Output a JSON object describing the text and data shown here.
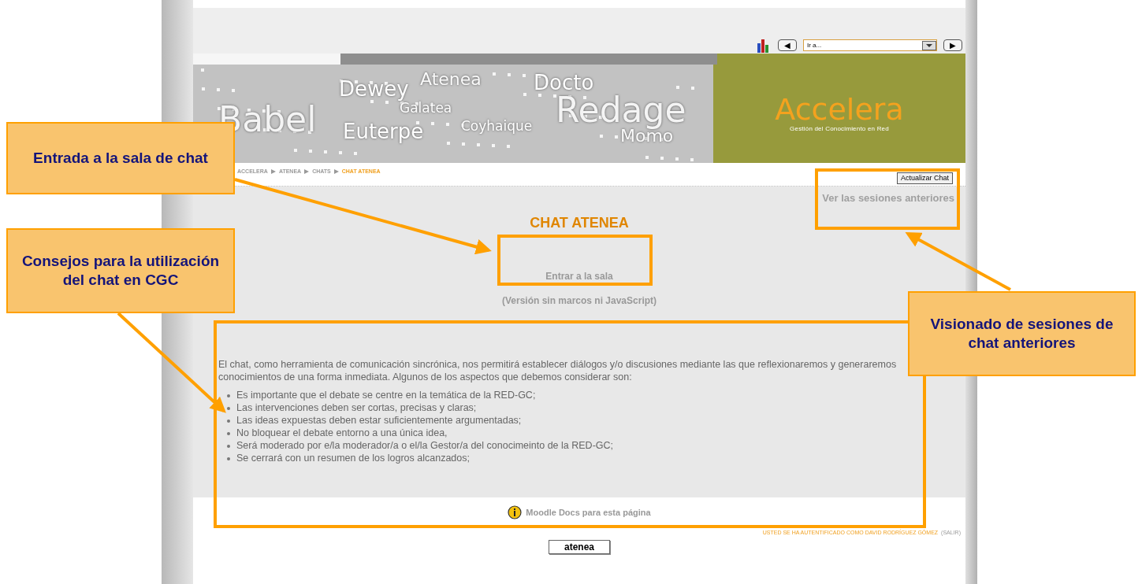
{
  "nav": {
    "prev": "◀",
    "select": "Ir a...",
    "next": "▶"
  },
  "banner": {
    "words": [
      {
        "text": "Babel",
        "kind": "big"
      },
      {
        "text": "Dewey",
        "kind": "mid"
      },
      {
        "text": "Atenea",
        "kind": "faint"
      },
      {
        "text": "Galatea",
        "kind": "small"
      },
      {
        "text": "Euterpe",
        "kind": "mid"
      },
      {
        "text": "Coyhaique",
        "kind": "small"
      },
      {
        "text": "Docto",
        "kind": "mid"
      },
      {
        "text": "Redage",
        "kind": "big"
      },
      {
        "text": "Momo",
        "kind": "faint"
      }
    ],
    "logo": "Accelera",
    "tagline": "Gestión del Conocimiento en Red"
  },
  "breadcrumb": [
    {
      "text": "ACCELERA",
      "selected": false
    },
    {
      "text": "ATENEA",
      "selected": false
    },
    {
      "text": "CHATS",
      "selected": false
    },
    {
      "text": "CHAT ATENEA",
      "selected": true
    }
  ],
  "refresh_button": "Actualizar Chat",
  "previous_sessions_link": "Ver las sesiones anteriores",
  "title": "CHAT ATENEA",
  "enter_link": "Entrar a la sala",
  "no_frames_link": "(Versión sin marcos ni JavaScript)",
  "intro": "El chat, como herramienta de comunicación sincrónica, nos permitirá establecer diálogos y/o discusiones mediante las que reflexionaremos y generaremos conocimientos de una forma inmediata. Algunos de los aspectos que debemos considerar son:",
  "tips": [
    "Es importante que el debate se centre en la temática de la RED-GC;",
    "Las intervenciones deben ser cortas, precisas y claras;",
    "Las ideas expuestas deben estar suficientemente argumentadas;",
    "No bloquear el debate entorno a una única idea,",
    "Será moderado por e/la moderador/a o el/la Gestor/a del conocimeinto de la RED-GC;",
    "Se cerrará con un resumen de los logros alcanzados;"
  ],
  "docs_link": "Moodle Docs para esta página",
  "login_info": {
    "text": "USTED SE HA AUTENTIFICADO COMO DAVID RODRÍGUEZ GÓMEZ",
    "logout": "(SALIR)"
  },
  "course_button": "atenea",
  "callouts": [
    {
      "text": "Entrada  a la sala de chat"
    },
    {
      "text": "Consejos para la utilización del chat en CGC"
    },
    {
      "text": "Visionado de sesiones de chat anteriores"
    }
  ]
}
